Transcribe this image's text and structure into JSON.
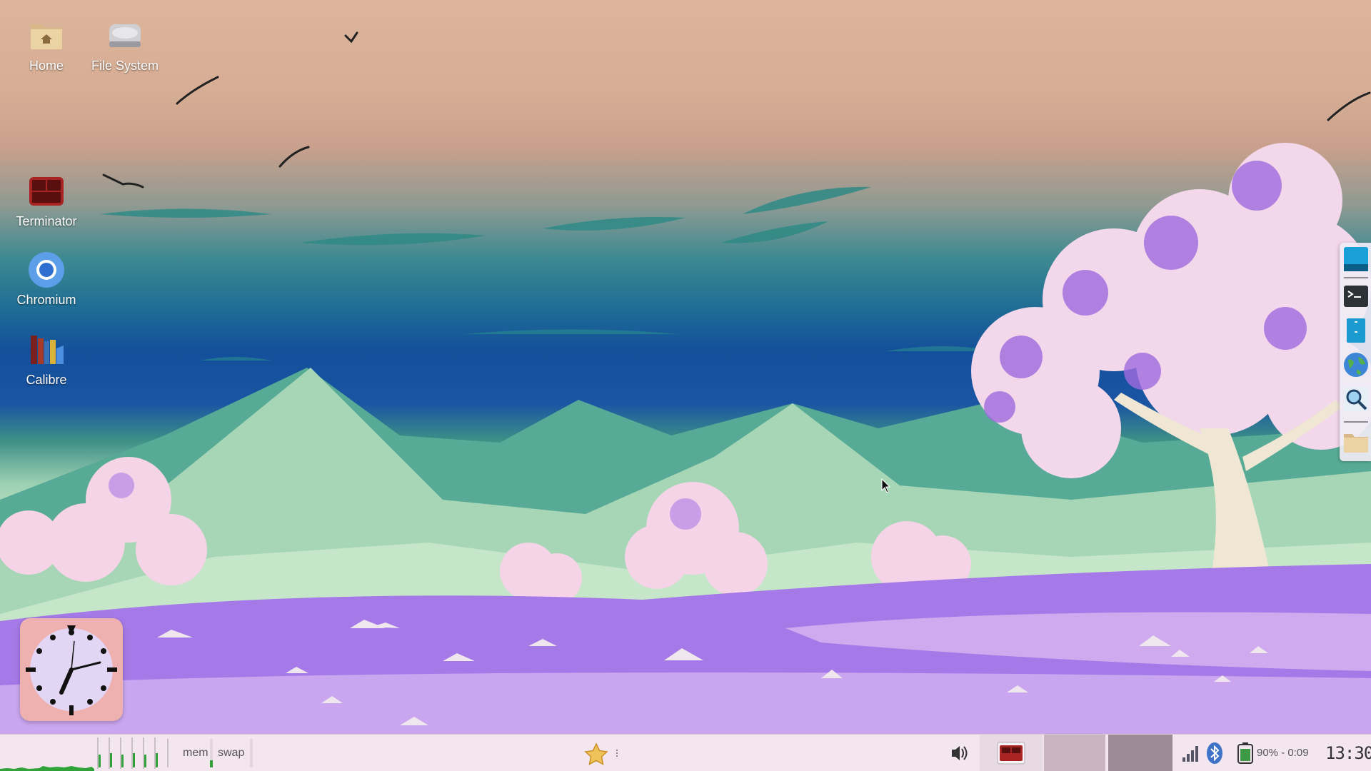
{
  "desktop": {
    "icons": [
      {
        "label": "Home",
        "icon": "home-folder-icon"
      },
      {
        "label": "File System",
        "icon": "drive-icon"
      },
      {
        "label": "Terminator",
        "icon": "terminator-icon"
      },
      {
        "label": "Chromium",
        "icon": "chromium-icon"
      },
      {
        "label": "Calibre",
        "icon": "calibre-icon"
      }
    ]
  },
  "dock": {
    "items": [
      "blue-window-icon",
      "terminal-icon",
      "archive-icon",
      "globe-icon",
      "search-icon",
      "folder-icon"
    ]
  },
  "taskbar": {
    "mem_label": "mem",
    "swap_label": "swap",
    "favorites_icon": "star-icon",
    "volume_icon": "speaker-icon",
    "network_icon": "signal-icon",
    "bluetooth_icon": "bluetooth-icon",
    "battery_text": "90% - 0:09",
    "clock_text": "13:30",
    "mem_fraction": 0.25
  },
  "colors": {
    "taskbar_bg": "#f3e6ef",
    "clock_widget_bg": "#efb0b0",
    "cpu_graph": "#31a23a"
  }
}
